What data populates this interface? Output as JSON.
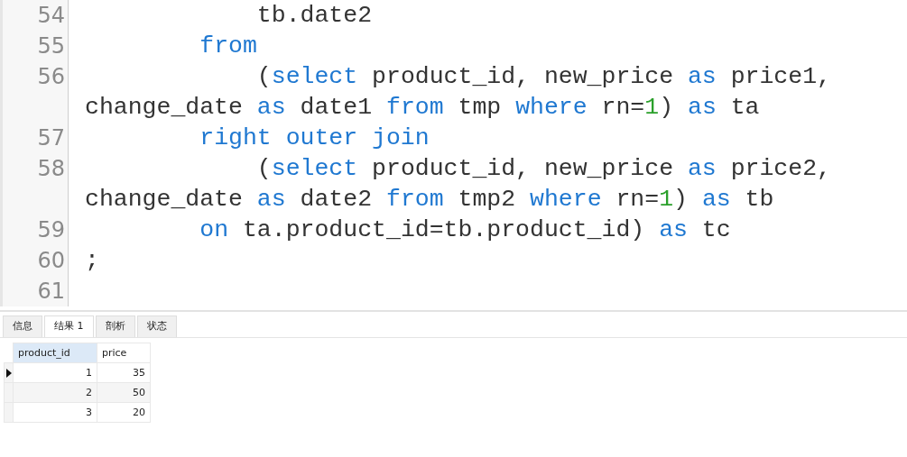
{
  "editor": {
    "lines": [
      {
        "number": "54",
        "tokens": [
          {
            "kind": "text",
            "text": "            tb.date2"
          }
        ]
      },
      {
        "number": "55",
        "tokens": [
          {
            "kind": "keyword",
            "text": "        from"
          }
        ]
      },
      {
        "number": "56",
        "tokens": [
          {
            "kind": "text",
            "text": "            ("
          },
          {
            "kind": "keyword",
            "text": "select"
          },
          {
            "kind": "text",
            "text": " product_id, new_price "
          },
          {
            "kind": "keyword",
            "text": "as"
          },
          {
            "kind": "text",
            "text": " price1, change_date "
          },
          {
            "kind": "keyword",
            "text": "as"
          },
          {
            "kind": "text",
            "text": " date1 "
          },
          {
            "kind": "keyword",
            "text": "from"
          },
          {
            "kind": "text",
            "text": " tmp "
          },
          {
            "kind": "keyword",
            "text": "where"
          },
          {
            "kind": "text",
            "text": " rn="
          },
          {
            "kind": "number",
            "text": "1"
          },
          {
            "kind": "text",
            "text": ") "
          },
          {
            "kind": "keyword",
            "text": "as"
          },
          {
            "kind": "text",
            "text": " ta"
          }
        ]
      },
      {
        "number": "57",
        "tokens": [
          {
            "kind": "keyword",
            "text": "        right outer join"
          }
        ]
      },
      {
        "number": "58",
        "tokens": [
          {
            "kind": "text",
            "text": "            ("
          },
          {
            "kind": "keyword",
            "text": "select"
          },
          {
            "kind": "text",
            "text": " product_id, new_price "
          },
          {
            "kind": "keyword",
            "text": "as"
          },
          {
            "kind": "text",
            "text": " price2, change_date "
          },
          {
            "kind": "keyword",
            "text": "as"
          },
          {
            "kind": "text",
            "text": " date2 "
          },
          {
            "kind": "keyword",
            "text": "from"
          },
          {
            "kind": "text",
            "text": " tmp2 "
          },
          {
            "kind": "keyword",
            "text": "where"
          },
          {
            "kind": "text",
            "text": " rn="
          },
          {
            "kind": "number",
            "text": "1"
          },
          {
            "kind": "text",
            "text": ") "
          },
          {
            "kind": "keyword",
            "text": "as"
          },
          {
            "kind": "text",
            "text": " tb"
          }
        ]
      },
      {
        "number": "59",
        "tokens": [
          {
            "kind": "keyword",
            "text": "        on"
          },
          {
            "kind": "text",
            "text": " ta.product_id=tb.product_id) "
          },
          {
            "kind": "keyword",
            "text": "as"
          },
          {
            "kind": "text",
            "text": " tc"
          }
        ]
      },
      {
        "number": "60",
        "tokens": [
          {
            "kind": "text",
            "text": ";"
          }
        ]
      },
      {
        "number": "61"
      }
    ]
  },
  "results": {
    "tabs": [
      {
        "label": "信息",
        "selected": false
      },
      {
        "label": "结果 1",
        "selected": true
      },
      {
        "label": "剖析",
        "selected": false
      },
      {
        "label": "状态",
        "selected": false
      }
    ],
    "table": {
      "columns": [
        {
          "label": "product_id",
          "selected": true
        },
        {
          "label": "price",
          "selected": false
        }
      ],
      "rows": [
        {
          "current": true,
          "cells": [
            "1",
            "35"
          ]
        },
        {
          "current": false,
          "cells": [
            "2",
            "50"
          ]
        },
        {
          "current": false,
          "cells": [
            "3",
            "20"
          ]
        }
      ]
    }
  }
}
